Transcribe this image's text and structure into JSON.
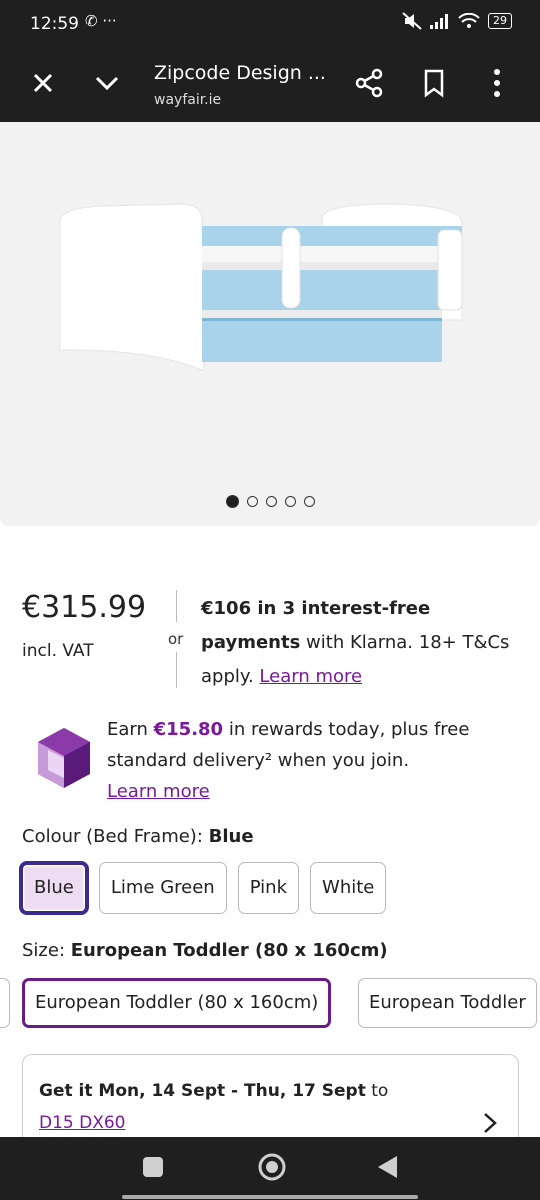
{
  "status_bar": {
    "time": "12:59",
    "left_icons": "✆ ···",
    "battery": "29"
  },
  "toolbar": {
    "title": "Zipcode Design ...",
    "url": "wayfair.ie"
  },
  "carousel": {
    "current": 1,
    "total": 5
  },
  "pricing": {
    "price": "€315.99",
    "vat": "incl. VAT",
    "or": "or",
    "klarna_bold": "€106 in 3 interest-free payments",
    "klarna_text": " with Klarna. 18+ T&Cs apply. ",
    "learn_more": "Learn more"
  },
  "rewards": {
    "prefix": "Earn ",
    "amount": "€15.80",
    "text": " in rewards today, plus free standard delivery² when you join.",
    "learn_more": "Learn more"
  },
  "colour": {
    "label": "Colour (Bed Frame): ",
    "selected": "Blue",
    "options": [
      "Blue",
      "Lime Green",
      "Pink",
      "White"
    ]
  },
  "size": {
    "label": "Size: ",
    "selected": "European Toddler (80 x 160cm)",
    "options": [
      "European Toddler (80 x 160cm)",
      "European Toddler"
    ]
  },
  "delivery": {
    "bold": "Get it Mon, 14 Sept - Thu, 17 Sept",
    "to": " to",
    "postcode": "D15 DX60"
  },
  "colors": {
    "accent": "#7b189f",
    "selected_border": "#3b2a8f",
    "selected_bg": "#eedcf3",
    "bed_blue": "#a9d3ea"
  }
}
